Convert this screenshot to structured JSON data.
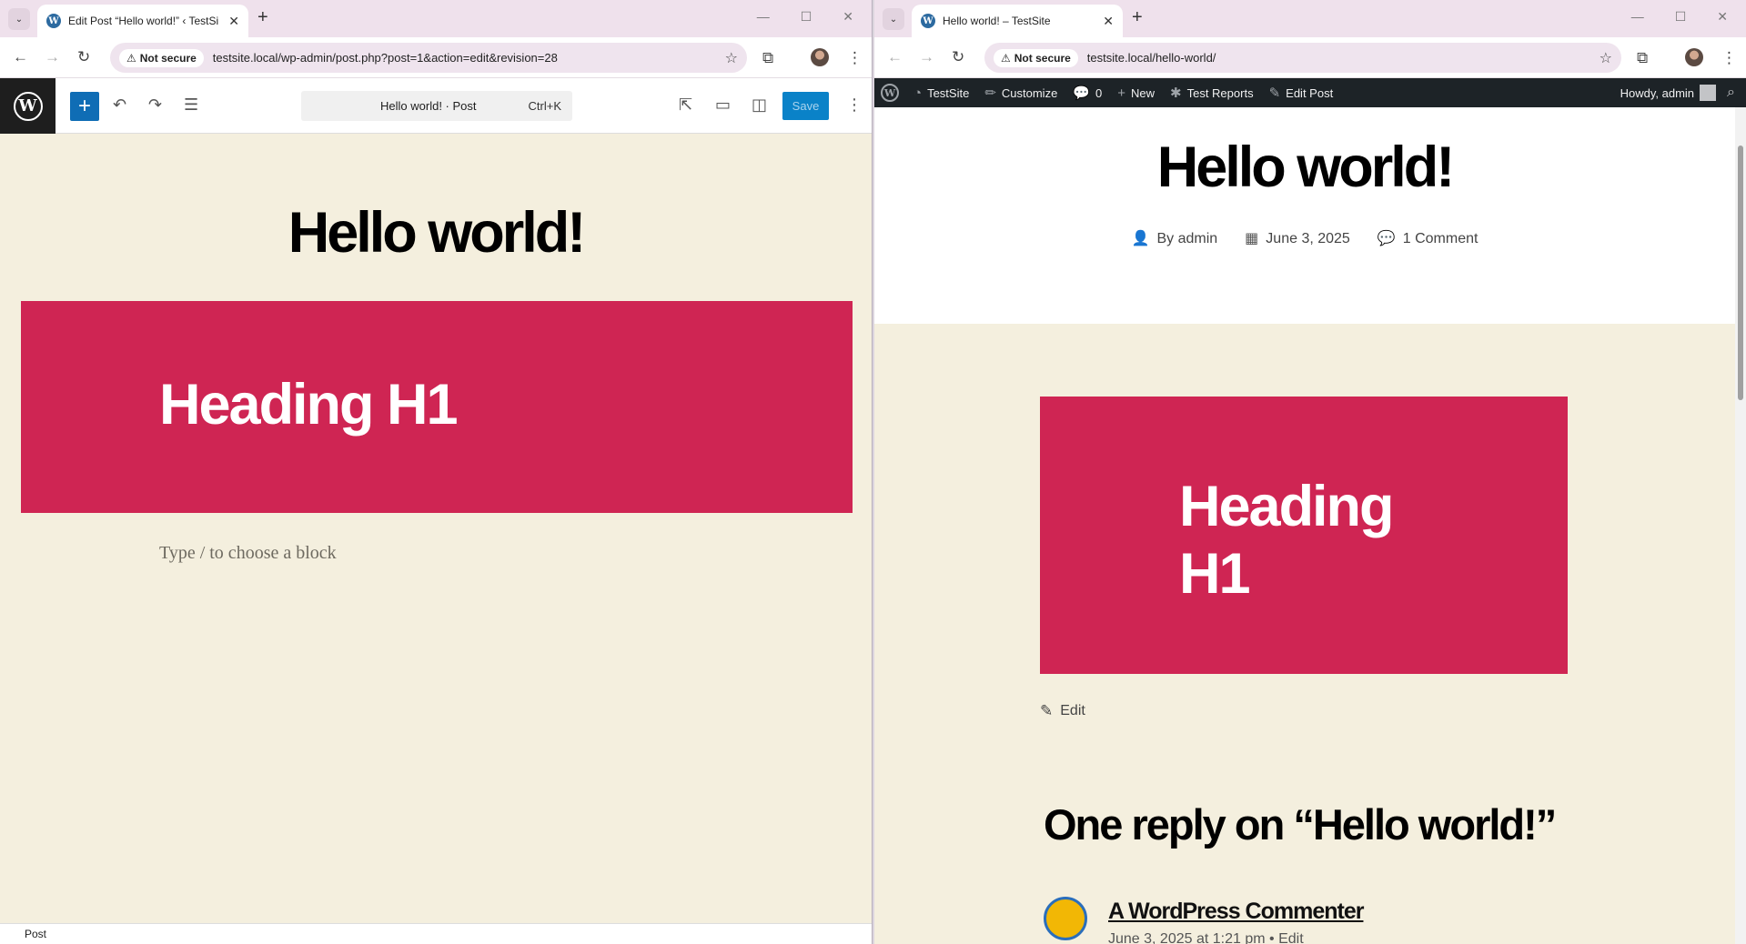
{
  "left": {
    "tab": {
      "title": "Edit Post “Hello world!” ‹ TestSi",
      "favicon": "W",
      "close": "✕"
    },
    "address": {
      "security": "Not secure",
      "url": "testsite.local/wp-admin/post.php?post=1&action=edit&revision=28"
    },
    "editor": {
      "wp_logo": "W",
      "command_bar": {
        "label": "Hello world! · Post",
        "shortcut": "Ctrl+K"
      },
      "save_label": "Save",
      "post_title": "Hello world!",
      "cover_heading": "Heading H1",
      "placeholder": "Type / to choose a block",
      "footer_breadcrumb": "Post"
    }
  },
  "right": {
    "tab": {
      "title": "Hello world! – TestSite",
      "favicon": "W",
      "close": "✕"
    },
    "address": {
      "security": "Not secure",
      "url": "testsite.local/hello-world/"
    },
    "admin_bar": {
      "site_name": "TestSite",
      "customize": "Customize",
      "comments_count": "0",
      "new": "New",
      "test_reports": "Test Reports",
      "edit_post": "Edit Post",
      "howdy": "Howdy, admin"
    },
    "post": {
      "title": "Hello world!",
      "author": "By admin",
      "date": "June 3, 2025",
      "comments": "1 Comment",
      "cover_heading": "Heading H1",
      "edit_link": "Edit"
    },
    "comments_section": {
      "heading": "One reply on “Hello world!”",
      "comment": {
        "author": "A WordPress Commenter",
        "meta": "June 3, 2025 at 1:21 pm • Edit"
      }
    }
  },
  "icons": {
    "tab_menu": "⌄",
    "new_tab": "+",
    "minimize": "—",
    "maximize": "☐",
    "close": "✕",
    "back": "←",
    "forward": "→",
    "reload": "↻",
    "warning": "⚠",
    "star": "☆",
    "extensions": "⧉",
    "kebab": "⋮",
    "plus": "+",
    "undo": "↶",
    "redo": "↷",
    "list_view": "☰",
    "external": "⇱",
    "preview": "▭",
    "settings": "◫",
    "user": "👤",
    "calendar": "▦",
    "comment": "💬",
    "pencil": "✎",
    "edit_square": "✎",
    "search": "⌕",
    "dashboard": "◔",
    "paintbrush": "✏",
    "bug": "✱"
  },
  "colors": {
    "accent": "#0a82c8",
    "cover": "#cf2553",
    "canvas": "#f4efde",
    "admin_bar": "#1d2327"
  }
}
